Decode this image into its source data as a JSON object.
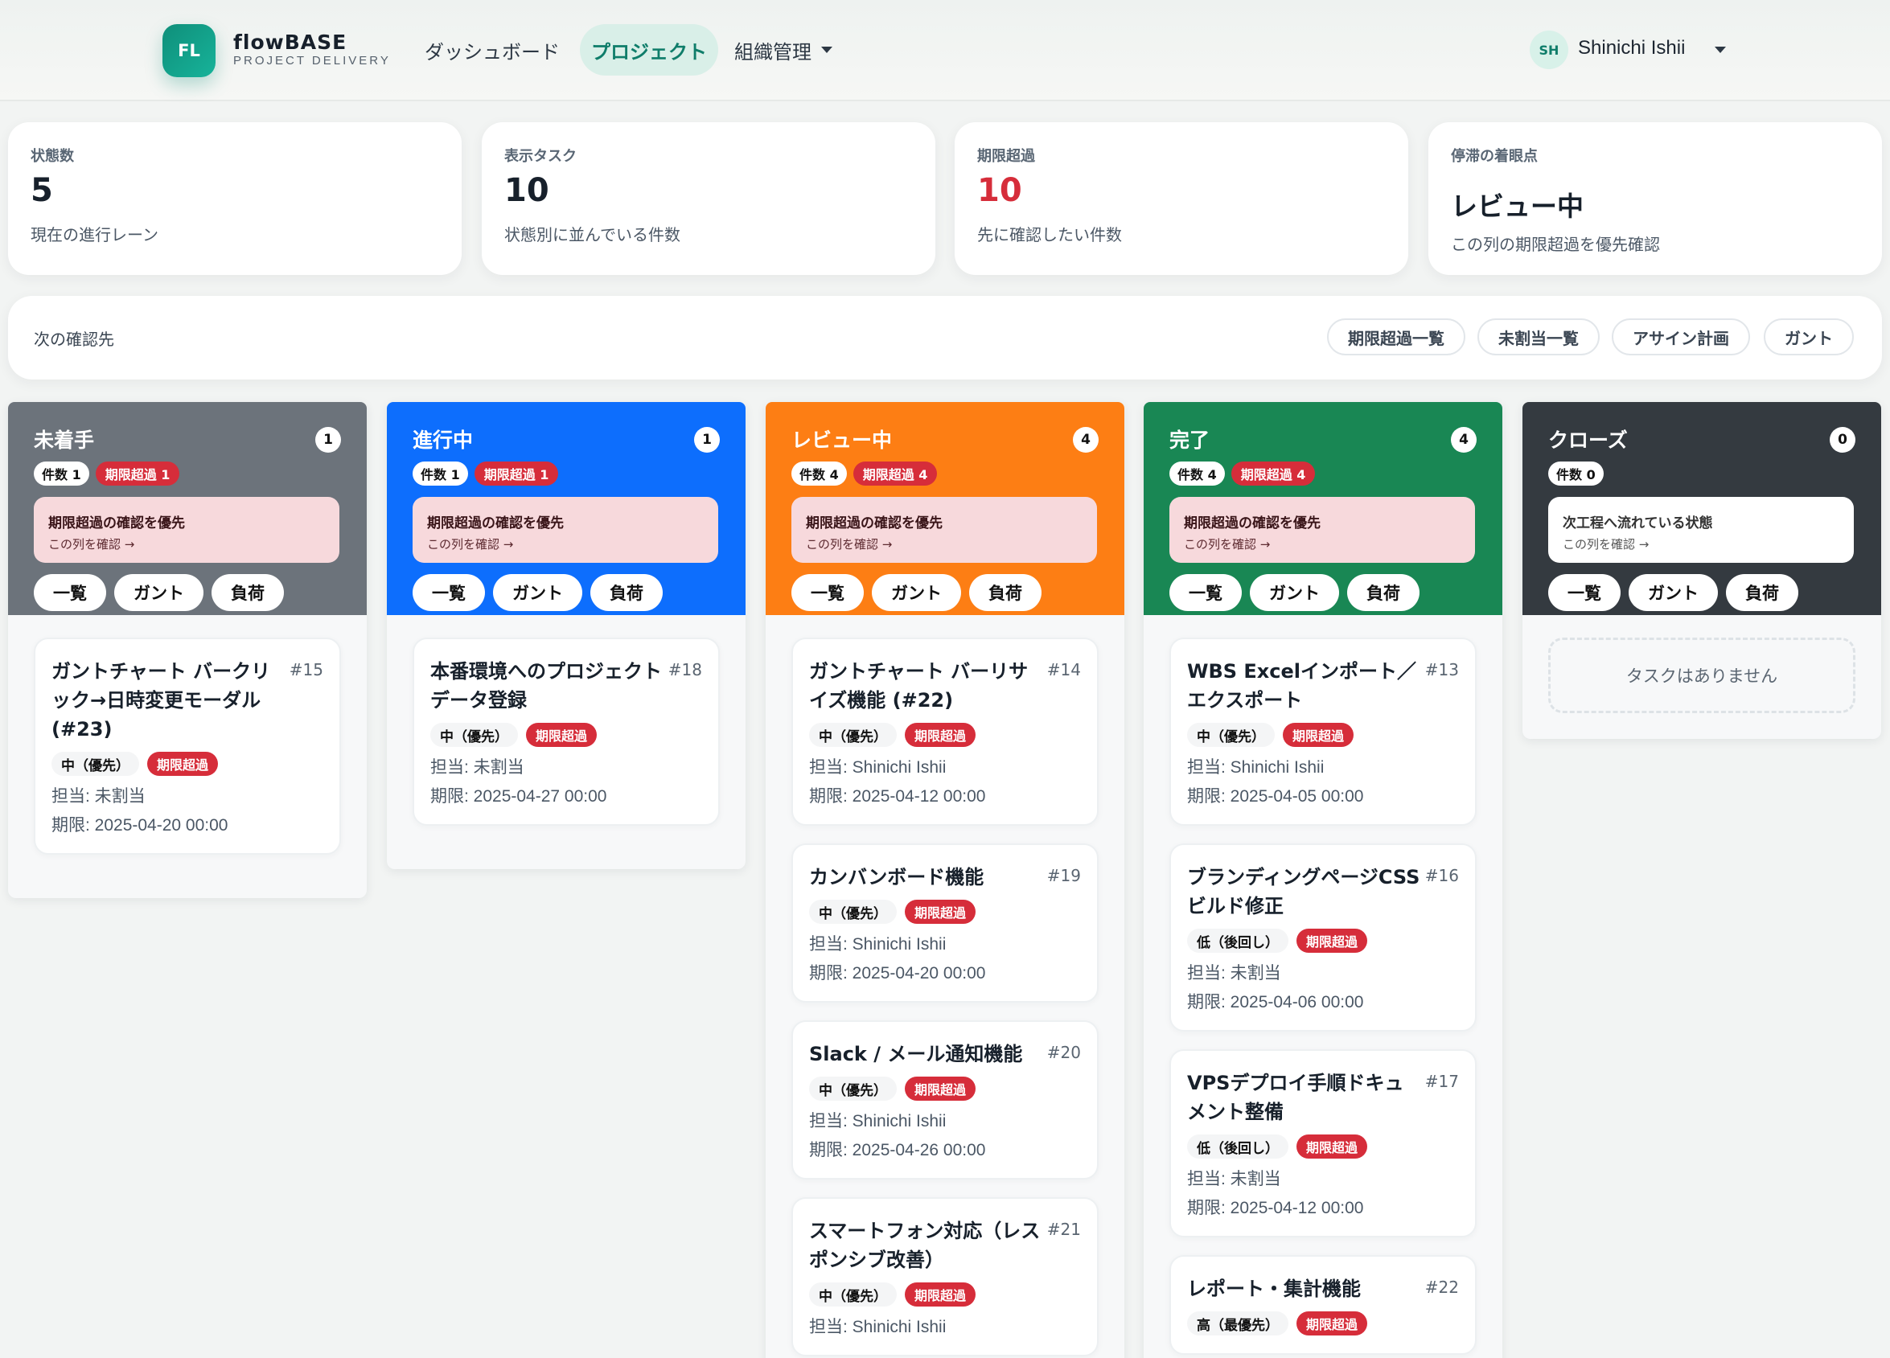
{
  "header": {
    "logo_initials": "FL",
    "brand_name": "flowBASE",
    "brand_sub": "PROJECT DELIVERY",
    "nav": [
      {
        "label": "ダッシュボード"
      },
      {
        "label": "プロジェクト"
      },
      {
        "label": "組織管理"
      }
    ],
    "user": {
      "initials": "SH",
      "name": "Shinichi Ishii"
    }
  },
  "stats": [
    {
      "label": "状態数",
      "value": "5",
      "desc": "現在の進行レーン"
    },
    {
      "label": "表示タスク",
      "value": "10",
      "desc": "状態別に並んでいる件数"
    },
    {
      "label": "期限超過",
      "value": "10",
      "desc": "先に確認したい件数"
    },
    {
      "label": "停滞の着眼点",
      "value": "レビュー中",
      "desc": "この列の期限超過を優先確認"
    }
  ],
  "next": {
    "label": "次の確認先",
    "buttons": [
      "期限超過一覧",
      "未割当一覧",
      "アサイン計画",
      "ガント"
    ]
  },
  "colors": {
    "todo": "#6c737b",
    "doing": "#0d6efd",
    "review": "#fd7e14",
    "done": "#198754",
    "closed": "#343a40",
    "accent": "#0f8f7a",
    "danger": "#d62d3a"
  },
  "columns": [
    {
      "title": "未着手",
      "count": "1",
      "count_chip": "件数 1",
      "over_chip": "期限超過 1",
      "alert_title": "期限超過の確認を優先",
      "alert_link": "この列を確認 →",
      "buttons": [
        "一覧",
        "ガント",
        "負荷"
      ],
      "tasks": [
        {
          "title": "ガントチャート バークリック→日時変更モーダル (#23)",
          "num": "#15",
          "priority": "中（優先）",
          "overdue": "期限超過",
          "assignee": "担当: 未割当",
          "due": "期限: 2025-04-20 00:00"
        }
      ]
    },
    {
      "title": "進行中",
      "count": "1",
      "count_chip": "件数 1",
      "over_chip": "期限超過 1",
      "alert_title": "期限超過の確認を優先",
      "alert_link": "この列を確認 →",
      "buttons": [
        "一覧",
        "ガント",
        "負荷"
      ],
      "tasks": [
        {
          "title": "本番環境へのプロジェクトデータ登録",
          "num": "#18",
          "priority": "中（優先）",
          "overdue": "期限超過",
          "assignee": "担当: 未割当",
          "due": "期限: 2025-04-27 00:00"
        }
      ]
    },
    {
      "title": "レビュー中",
      "count": "4",
      "count_chip": "件数 4",
      "over_chip": "期限超過 4",
      "alert_title": "期限超過の確認を優先",
      "alert_link": "この列を確認 →",
      "buttons": [
        "一覧",
        "ガント",
        "負荷"
      ],
      "tasks": [
        {
          "title": "ガントチャート バーリサイズ機能 (#22)",
          "num": "#14",
          "priority": "中（優先）",
          "overdue": "期限超過",
          "assignee": "担当: Shinichi Ishii",
          "due": "期限: 2025-04-12 00:00"
        },
        {
          "title": "カンバンボード機能",
          "num": "#19",
          "priority": "中（優先）",
          "overdue": "期限超過",
          "assignee": "担当: Shinichi Ishii",
          "due": "期限: 2025-04-20 00:00"
        },
        {
          "title": "Slack / メール通知機能",
          "num": "#20",
          "priority": "中（優先）",
          "overdue": "期限超過",
          "assignee": "担当: Shinichi Ishii",
          "due": "期限: 2025-04-26 00:00"
        },
        {
          "title": "スマートフォン対応（レスポンシブ改善）",
          "num": "#21",
          "priority": "中（優先）",
          "overdue": "期限超過",
          "assignee": "担当: Shinichi Ishii",
          "due": ""
        }
      ]
    },
    {
      "title": "完了",
      "count": "4",
      "count_chip": "件数 4",
      "over_chip": "期限超過 4",
      "alert_title": "期限超過の確認を優先",
      "alert_link": "この列を確認 →",
      "buttons": [
        "一覧",
        "ガント",
        "負荷"
      ],
      "tasks": [
        {
          "title": "WBS Excelインポート／エクスポート",
          "num": "#13",
          "priority": "中（優先）",
          "overdue": "期限超過",
          "assignee": "担当: Shinichi Ishii",
          "due": "期限: 2025-04-05 00:00"
        },
        {
          "title": "ブランディングページCSSビルド修正",
          "num": "#16",
          "priority": "低（後回し）",
          "overdue": "期限超過",
          "assignee": "担当: 未割当",
          "due": "期限: 2025-04-06 00:00"
        },
        {
          "title": "VPSデプロイ手順ドキュメント整備",
          "num": "#17",
          "priority": "低（後回し）",
          "overdue": "期限超過",
          "assignee": "担当: 未割当",
          "due": "期限: 2025-04-12 00:00"
        },
        {
          "title": "レポート・集計機能",
          "num": "#22",
          "priority": "高（最優先）",
          "overdue": "期限超過",
          "assignee": "",
          "due": ""
        }
      ]
    },
    {
      "title": "クローズ",
      "count": "0",
      "count_chip": "件数 0",
      "alert_title": "次工程へ流れている状態",
      "alert_link": "この列を確認 →",
      "buttons": [
        "一覧",
        "ガント",
        "負荷"
      ],
      "empty": "タスクはありません"
    }
  ]
}
